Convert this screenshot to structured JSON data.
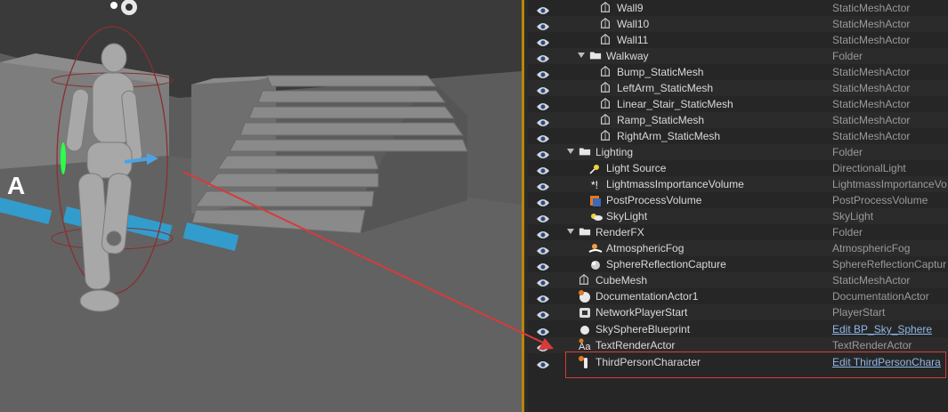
{
  "outliner": {
    "rows": [
      {
        "label": "Wall9",
        "type": "StaticMeshActor",
        "icon": "static-mesh-icon",
        "indent": 84,
        "type_link": false
      },
      {
        "label": "Wall10",
        "type": "StaticMeshActor",
        "icon": "static-mesh-icon",
        "indent": 84,
        "type_link": false
      },
      {
        "label": "Wall11",
        "type": "StaticMeshActor",
        "icon": "static-mesh-icon",
        "indent": 84,
        "type_link": false
      },
      {
        "label": "Walkway",
        "type": "Folder",
        "icon": "folder-icon",
        "indent": 72,
        "type_link": false,
        "expanded": true
      },
      {
        "label": "Bump_StaticMesh",
        "type": "StaticMeshActor",
        "icon": "static-mesh-icon",
        "indent": 84,
        "type_link": false
      },
      {
        "label": "LeftArm_StaticMesh",
        "type": "StaticMeshActor",
        "icon": "static-mesh-icon",
        "indent": 84,
        "type_link": false
      },
      {
        "label": "Linear_Stair_StaticMesh",
        "type": "StaticMeshActor",
        "icon": "static-mesh-icon",
        "indent": 84,
        "type_link": false
      },
      {
        "label": "Ramp_StaticMesh",
        "type": "StaticMeshActor",
        "icon": "static-mesh-icon",
        "indent": 84,
        "type_link": false
      },
      {
        "label": "RightArm_StaticMesh",
        "type": "StaticMeshActor",
        "icon": "static-mesh-icon",
        "indent": 84,
        "type_link": false
      },
      {
        "label": "Lighting",
        "type": "Folder",
        "icon": "folder-icon",
        "indent": 60,
        "type_link": false,
        "expanded": true
      },
      {
        "label": "Light Source",
        "type": "DirectionalLight",
        "icon": "directional-light-icon",
        "indent": 72,
        "type_link": false
      },
      {
        "label": "LightmassImportanceVolume",
        "type": "LightmassImportanceVo",
        "icon": "lightmass-volume-icon",
        "indent": 72,
        "type_link": false
      },
      {
        "label": "PostProcessVolume",
        "type": "PostProcessVolume",
        "icon": "postprocess-volume-icon",
        "indent": 72,
        "type_link": false
      },
      {
        "label": "SkyLight",
        "type": "SkyLight",
        "icon": "skylight-icon",
        "indent": 72,
        "type_link": false
      },
      {
        "label": "RenderFX",
        "type": "Folder",
        "icon": "folder-icon",
        "indent": 60,
        "type_link": false,
        "expanded": true
      },
      {
        "label": "AtmosphericFog",
        "type": "AtmosphericFog",
        "icon": "atmospheric-fog-icon",
        "indent": 72,
        "type_link": false
      },
      {
        "label": "SphereReflectionCapture",
        "type": "SphereReflectionCaptur",
        "icon": "sphere-reflection-icon",
        "indent": 72,
        "type_link": false
      },
      {
        "label": "CubeMesh",
        "type": "StaticMeshActor",
        "icon": "static-mesh-icon",
        "indent": 60,
        "type_link": false
      },
      {
        "label": "DocumentationActor1",
        "type": "DocumentationActor",
        "icon": "documentation-actor-icon",
        "indent": 60,
        "type_link": false
      },
      {
        "label": "NetworkPlayerStart",
        "type": "PlayerStart",
        "icon": "player-start-icon",
        "indent": 60,
        "type_link": false
      },
      {
        "label": "SkySphereBlueprint",
        "type": "Edit BP_Sky_Sphere",
        "icon": "sky-sphere-icon",
        "indent": 60,
        "type_link": true
      },
      {
        "label": "TextRenderActor",
        "type": "TextRenderActor",
        "icon": "text-render-icon",
        "indent": 60,
        "type_link": false
      },
      {
        "label": "ThirdPersonCharacter",
        "type": "Edit ThirdPersonChara",
        "icon": "character-icon",
        "indent": 60,
        "type_link": true
      }
    ]
  },
  "viewport": {
    "floor_text": "A",
    "accent_color": "#b8860b",
    "highlight_color": "#d83a3a",
    "floor_text_color": "#2aa7e0"
  }
}
